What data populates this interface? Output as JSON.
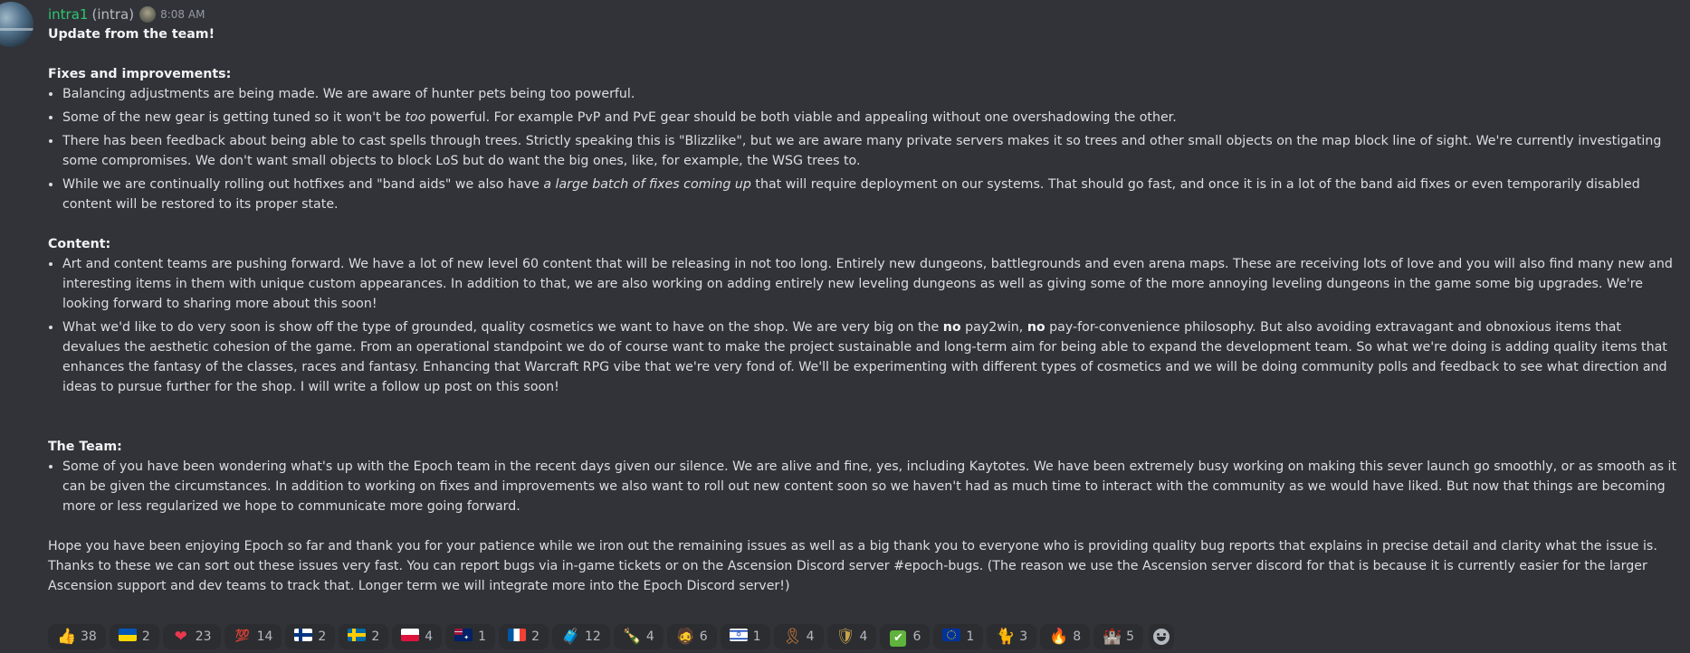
{
  "author": {
    "username": "intra1",
    "suffix": "(intra)",
    "timestamp": "8:08 AM"
  },
  "message": {
    "title": "Update from the team!",
    "section1": {
      "heading": "Fixes and improvements:",
      "items": [
        "Balancing adjustments are being made. We are aware of hunter pets being too powerful.",
        {
          "pre": "Some of the new gear is getting tuned so it won't be ",
          "em": "too",
          "post": " powerful. For example PvP and PvE gear should be both viable and appealing without one overshadowing the other."
        },
        "There has been feedback about being able to cast spells through trees. Strictly speaking this is \"Blizzlike\", but we are aware many private servers makes it so trees and other small objects on the map block line of sight. We're currently investigating some compromises. We don't want small objects to block LoS but do want the big ones, like, for example, the WSG trees to.",
        {
          "pre": "While we are continually rolling out hotfixes and \"band aids\" we also have ",
          "em": "a large batch of fixes coming up",
          "post": " that will require deployment on our systems. That should go fast, and once it is in a lot of the band aid fixes or even temporarily disabled content will be restored to its proper state."
        }
      ]
    },
    "section2": {
      "heading": "Content:",
      "items": [
        "Art and content teams are pushing forward. We have a lot of new level 60 content that will be releasing in not too long. Entirely new dungeons, battlegrounds and even arena maps. These are receiving lots of love and you will also find many new and interesting items in them with unique custom appearances. In addition to that, we are also working on adding entirely new leveling dungeons as well as giving some of the more annoying leveling dungeons in the game some big upgrades. We're looking forward to sharing more about this soon!",
        {
          "a": "What we'd like to do very soon is show off the type of grounded, quality cosmetics we want to have on the shop. We are very big on the ",
          "b1": "no",
          "c": " pay2win, ",
          "b2": "no",
          "d": " pay-for-convenience philosophy. But also avoiding extravagant and obnoxious items that devalues the aesthetic cohesion of the game. From an operational standpoint we do of course want to make the project sustainable and long-term aim for being able to expand the development team. So what we're doing is adding quality items that enhances the fantasy of the classes, races and fantasy. Enhancing that Warcraft RPG vibe that we're very fond of. We'll be experimenting with different types of cosmetics and we will be doing community polls and feedback to see what direction and ideas to pursue further for the shop. I will write a follow up post on this soon!"
        }
      ]
    },
    "section3": {
      "heading": "The Team:",
      "items": [
        "Some of you have been wondering what's up with the Epoch team in the recent days given our silence. We are alive and fine, yes, including Kaytotes. We have been extremely busy working on making this sever launch go smoothly, or as smooth as it can be given the circumstances. In addition to working on fixes and improvements we also want to roll out new content soon so we haven't had as much time to interact with the community as we would have liked. But now that things are becoming more or less regularized we hope to communicate more going forward."
      ]
    },
    "closing": "Hope you have been enjoying Epoch so far and thank you for your patience while we iron out the remaining issues as well as a big thank you to everyone who is providing quality bug reports that explains in precise detail and clarity what the issue is. Thanks to these we can sort out these issues very fast. You can report bugs via in-game tickets or on the Ascension Discord server #epoch-bugs. (The reason we use the Ascension server discord for that is because it is currently easier for the larger Ascension support and dev teams to track that. Longer term we will integrate more into the Epoch Discord server!)"
  },
  "reactions": [
    {
      "icon": "thumbs-up",
      "glyph": "👍",
      "count": "38"
    },
    {
      "icon": "ukraine-flag",
      "count": "2"
    },
    {
      "icon": "red-heart",
      "glyph": "❤",
      "count": "23"
    },
    {
      "icon": "hundred-points",
      "glyph": "💯",
      "count": "14"
    },
    {
      "icon": "finland-flag",
      "count": "2"
    },
    {
      "icon": "sweden-flag",
      "count": "2"
    },
    {
      "icon": "poland-flag",
      "count": "4"
    },
    {
      "icon": "australia-flag",
      "count": "1"
    },
    {
      "icon": "france-flag",
      "count": "2"
    },
    {
      "icon": "custom-emoji-chest",
      "glyph": "🧳",
      "count": "12"
    },
    {
      "icon": "custom-emoji-figure",
      "glyph": "🍾",
      "count": "4"
    },
    {
      "icon": "custom-emoji-face",
      "glyph": "🧔",
      "count": "6"
    },
    {
      "icon": "israel-flag",
      "count": "1"
    },
    {
      "icon": "custom-emoji-ribbon",
      "glyph": "🎗",
      "count": "4"
    },
    {
      "icon": "custom-emoji-alliance",
      "glyph": "🛡",
      "count": "4"
    },
    {
      "icon": "check-mark",
      "glyph": "✔",
      "count": "6"
    },
    {
      "icon": "eu-flag",
      "count": "1"
    },
    {
      "icon": "cat",
      "glyph": "🐈",
      "count": "3"
    },
    {
      "icon": "fire",
      "glyph": "🔥",
      "count": "8"
    },
    {
      "icon": "custom-emoji-castle",
      "glyph": "🏰",
      "count": "5"
    }
  ]
}
